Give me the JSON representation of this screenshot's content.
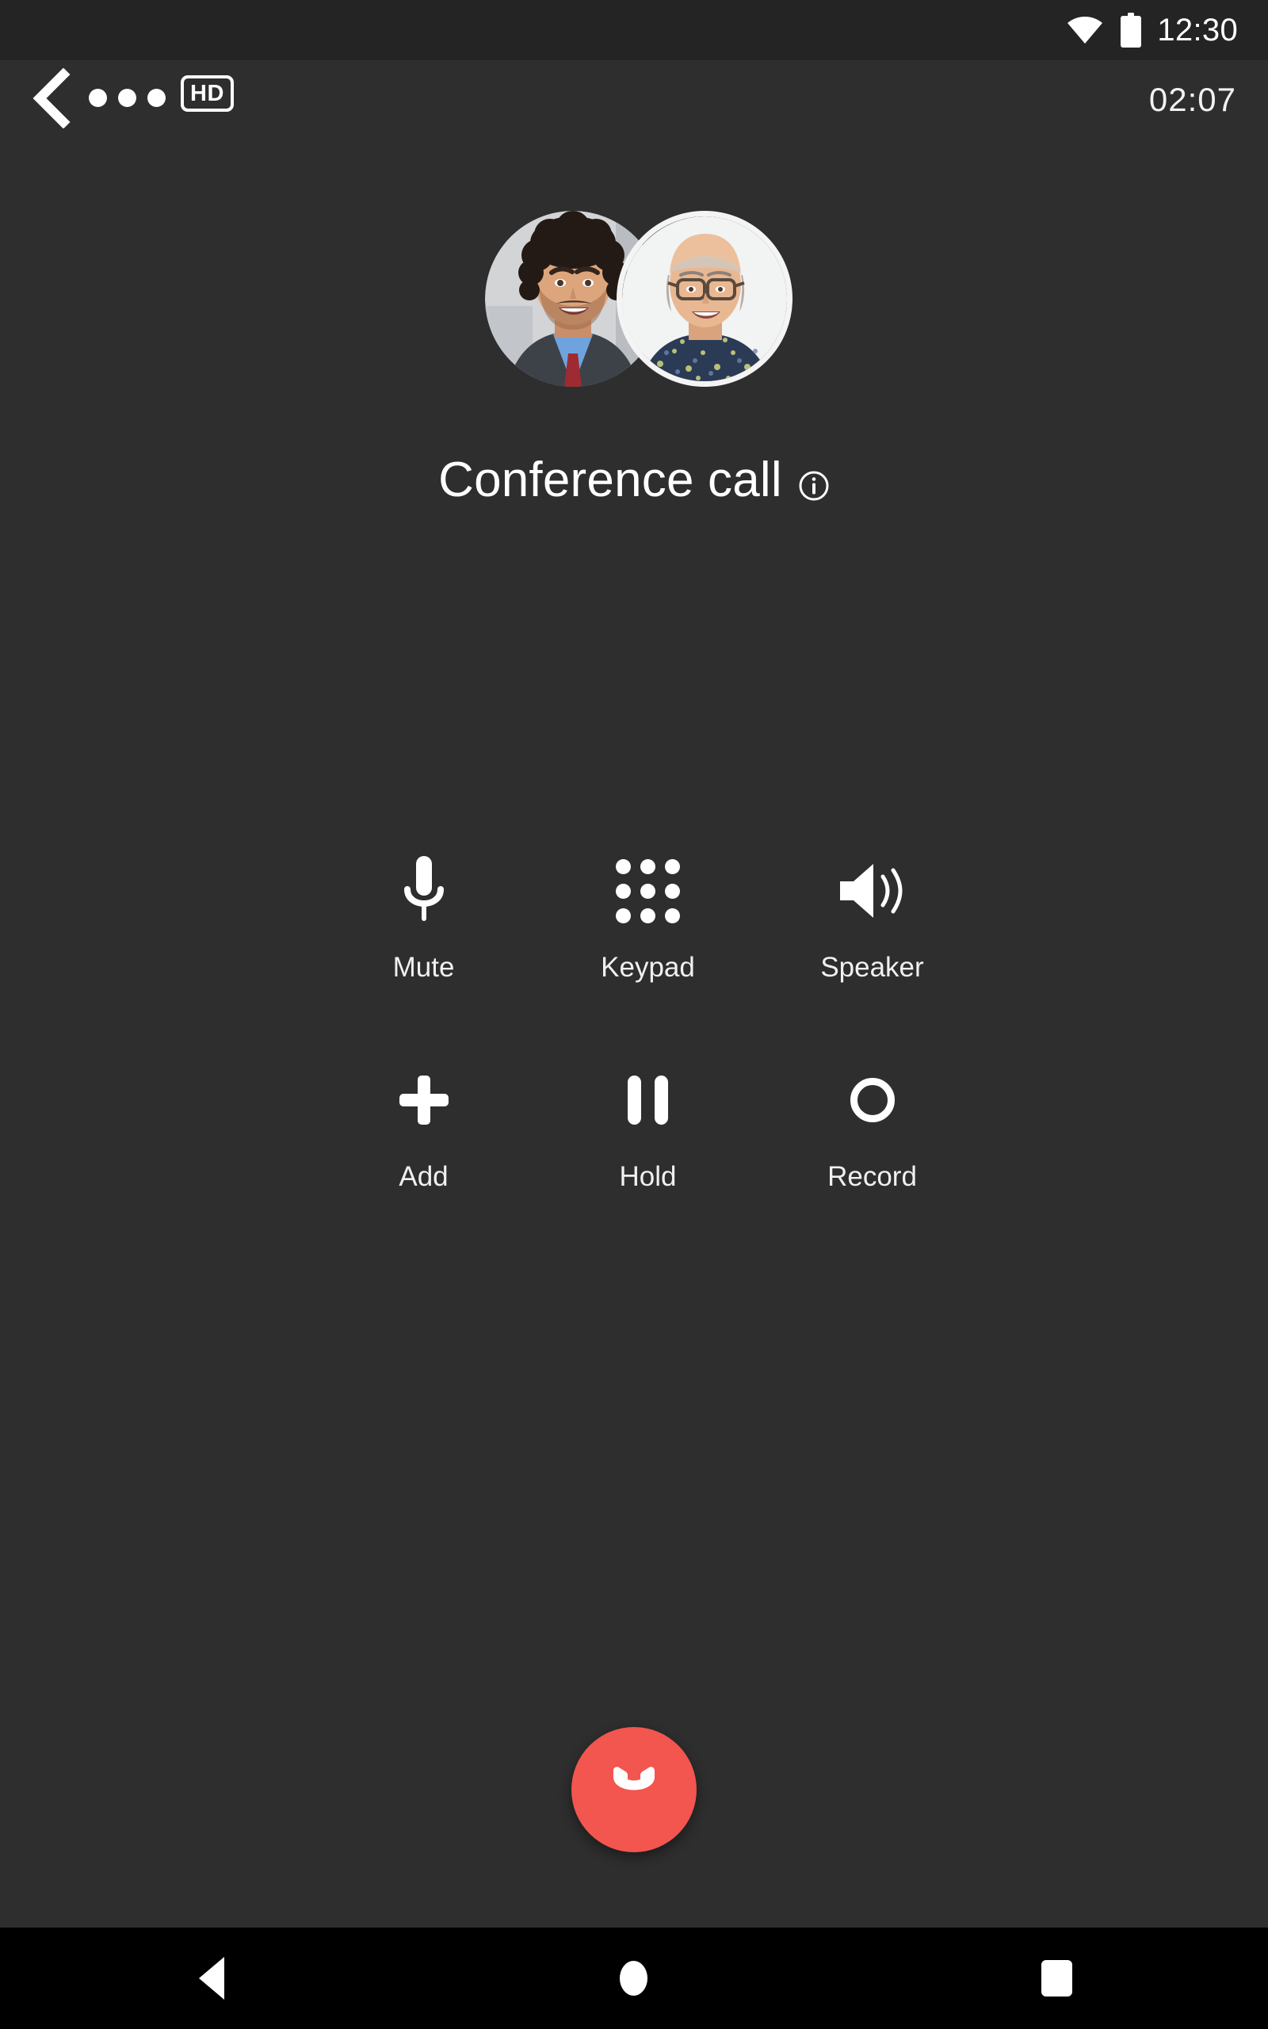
{
  "status_bar": {
    "time": "12:30",
    "wifi_icon": "wifi-icon",
    "battery_icon": "battery-full-icon"
  },
  "call_header": {
    "back_icon": "back-chevron-icon",
    "more_icon": "more-options-dots-icon",
    "hd_badge": "HD",
    "duration": "02:07"
  },
  "participants": {
    "avatar_1": "avatar-participant-1",
    "avatar_2": "avatar-participant-2"
  },
  "call_info": {
    "title": "Conference call",
    "info_icon": "info-circle-icon"
  },
  "actions": {
    "rows": [
      [
        {
          "label": "Mute",
          "icon": "microphone-icon"
        },
        {
          "label": "Keypad",
          "icon": "dialpad-icon"
        },
        {
          "label": "Speaker",
          "icon": "speaker-icon"
        }
      ],
      [
        {
          "label": "Add",
          "icon": "plus-icon"
        },
        {
          "label": "Hold",
          "icon": "pause-icon"
        },
        {
          "label": "Record",
          "icon": "record-circle-icon"
        }
      ]
    ]
  },
  "end_call": {
    "icon": "end-call-handset-icon",
    "color": "#f2564f"
  },
  "nav_bar": {
    "back": "nav-back-triangle-icon",
    "home": "nav-home-circle-icon",
    "recents": "nav-recents-square-icon"
  },
  "colors": {
    "background": "#2e2e2e",
    "status_bar": "#242424",
    "nav_bar": "#000000",
    "text": "#ffffff",
    "end_call": "#f2564f"
  }
}
